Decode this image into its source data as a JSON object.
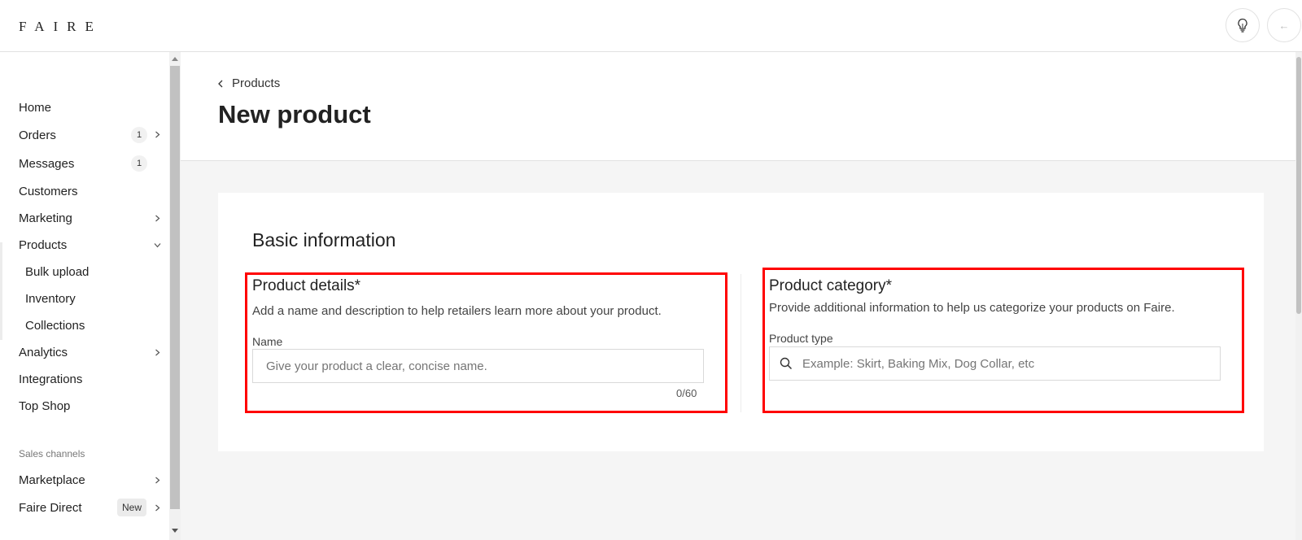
{
  "brand": {
    "logo": "FAIRE"
  },
  "topbar": {
    "bulb_icon": "lightbulb-icon",
    "back_icon": "arrow-left-icon"
  },
  "sidebar": {
    "items": [
      {
        "label": "Home"
      },
      {
        "label": "Orders",
        "badge": "1",
        "has_chevron": true
      },
      {
        "label": "Messages",
        "badge": "1"
      },
      {
        "label": "Customers"
      },
      {
        "label": "Marketing",
        "has_chevron": true
      },
      {
        "label": "Products",
        "expanded": true
      },
      {
        "label": "Bulk upload"
      },
      {
        "label": "Inventory"
      },
      {
        "label": "Collections"
      },
      {
        "label": "Analytics",
        "has_chevron": true
      },
      {
        "label": "Integrations"
      },
      {
        "label": "Top Shop"
      }
    ],
    "section_label": "Sales channels",
    "channels": [
      {
        "label": "Marketplace",
        "has_chevron": true
      },
      {
        "label": "Faire Direct",
        "pill": "New",
        "has_chevron": true
      }
    ]
  },
  "header": {
    "breadcrumb": "Products",
    "title": "New product"
  },
  "basic_info": {
    "title": "Basic information",
    "details": {
      "title": "Product details*",
      "description": "Add a name and description to help retailers learn more about your product.",
      "name_label": "Name",
      "name_value": "",
      "name_placeholder": "Give your product a clear, concise name.",
      "counter": "0/60"
    },
    "category": {
      "title": "Product category*",
      "description": "Provide additional information to help us categorize your products on Faire.",
      "type_label": "Product type",
      "type_value": "",
      "type_placeholder": "Example: Skirt, Baking Mix, Dog Collar, etc"
    }
  },
  "colors": {
    "highlight": "#ff0000",
    "page_bg": "#f5f5f5"
  }
}
